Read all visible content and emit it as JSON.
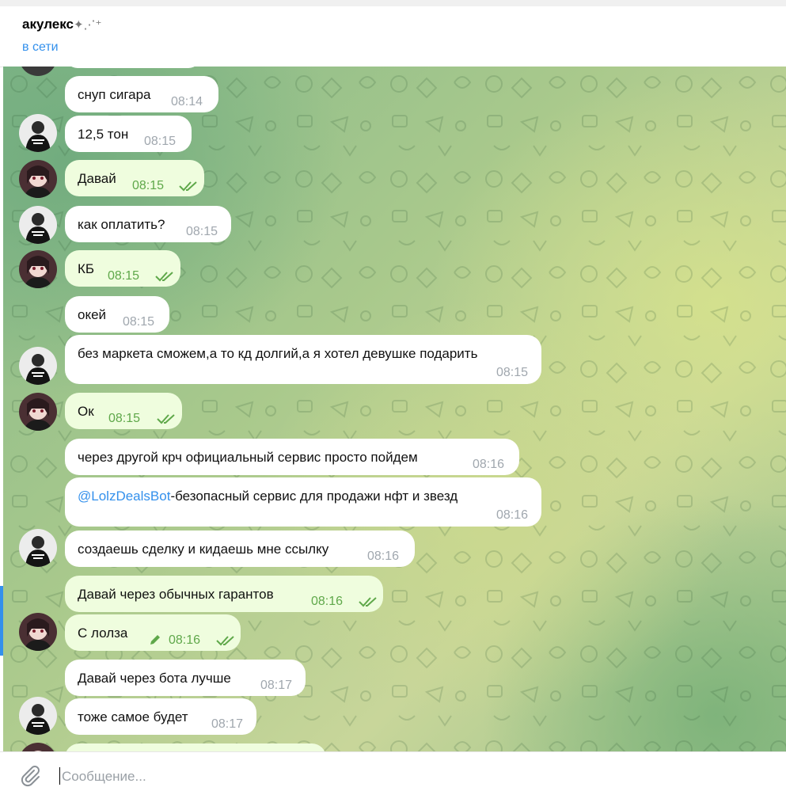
{
  "header": {
    "title": "акулекс",
    "title_decoration": "sparkles-emoji",
    "status": "в сети"
  },
  "messages": [
    {
      "dir": "in",
      "text": "снуп сигара",
      "time": "08:14"
    },
    {
      "dir": "in",
      "text": "12,5 тон",
      "time": "08:15"
    },
    {
      "dir": "out",
      "text": "Давай",
      "time": "08:15",
      "read": true
    },
    {
      "dir": "in",
      "text": "как оплатить?",
      "time": "08:15"
    },
    {
      "dir": "out",
      "text": "КБ",
      "time": "08:15",
      "read": true
    },
    {
      "dir": "in",
      "text": "окей",
      "time": "08:15"
    },
    {
      "dir": "in",
      "text": "без маркета сможем,а то кд долгий,а я хотел девушке подарить",
      "time": "08:15"
    },
    {
      "dir": "out",
      "text": "Ок",
      "time": "08:15",
      "read": true
    },
    {
      "dir": "in",
      "text": "через другой крч официальный сервис просто пойдем",
      "time": "08:16"
    },
    {
      "dir": "in",
      "link": "@LolzDealsBot",
      "text": "-безопасный сервис для продажи нфт и звезд",
      "time": "08:16"
    },
    {
      "dir": "in",
      "text": "создаешь сделку и кидаешь мне ссылку",
      "time": "08:16"
    },
    {
      "dir": "out",
      "text": "Давай через обычных гарантов",
      "time": "08:16",
      "read": true
    },
    {
      "dir": "out",
      "text": "С лолза",
      "time": "08:16",
      "read": true,
      "edited": true
    },
    {
      "dir": "in",
      "text": "Давай через бота лучше",
      "time": "08:17"
    },
    {
      "dir": "in",
      "text": "тоже самое будет",
      "time": "08:17"
    }
  ],
  "input": {
    "placeholder": "Сообщение..."
  },
  "icons": {
    "attach": "paperclip-icon",
    "read_status": "double-check-icon",
    "edited": "pencil-icon"
  },
  "colors": {
    "accent": "#3390ec",
    "outgoing_bubble": "#effdde",
    "incoming_bubble": "#ffffff",
    "read_check": "#5fa84a"
  }
}
